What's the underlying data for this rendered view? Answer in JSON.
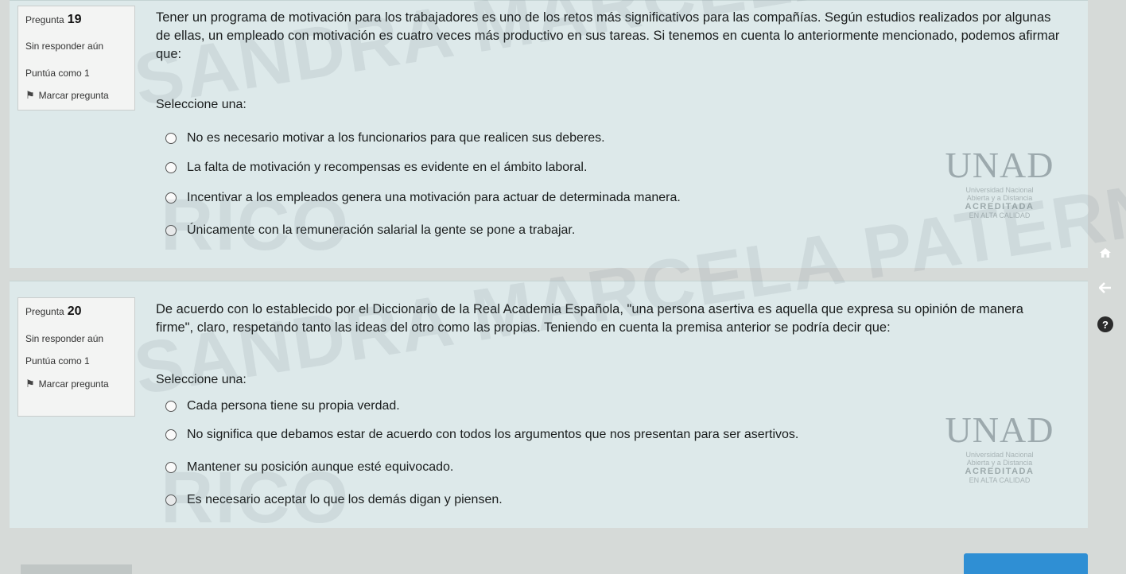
{
  "questions": [
    {
      "label": "Pregunta",
      "number": "19",
      "status": "Sin responder aún",
      "score": "Puntúa como 1",
      "flag_label": "Marcar pregunta",
      "text": "Tener un programa de motivación para los trabajadores es uno de los retos más significativos para las compañías. Según estudios realizados por algunas de ellas, un empleado con motivación es cuatro veces más productivo en sus tareas. Si tenemos en cuenta lo anteriormente mencionado, podemos afirmar que:",
      "prompt": "Seleccione una:",
      "options": [
        "No es necesario motivar a los funcionarios para que realicen sus deberes.",
        "La falta de motivación y recompensas es evidente en el ámbito laboral.",
        "Incentivar a los empleados genera una motivación para actuar de determinada manera.",
        "Únicamente con la remuneración salarial la gente se pone a trabajar."
      ]
    },
    {
      "label": "Pregunta",
      "number": "20",
      "status": "Sin responder aún",
      "score": "Puntúa como 1",
      "flag_label": "Marcar pregunta",
      "text": "De acuerdo con lo establecido por el Diccionario de la Real Academia Española, \"una persona asertiva es aquella que expresa su opinión de manera firme\", claro, respetando tanto las ideas del otro como las propias. Teniendo en cuenta la premisa anterior se podría decir que:",
      "prompt": "Seleccione una:",
      "options": [
        "Cada persona tiene su propia verdad.",
        "No significa que debamos estar de acuerdo con todos los argumentos que nos presentan para ser asertivos.",
        "Mantener su posición aunque esté equivocado.",
        "Es necesario aceptar lo que los demás digan y piensen."
      ]
    }
  ],
  "watermark": {
    "line1": "SANDRA MARCELA PATERNINA",
    "line2": "RICO"
  },
  "logo": {
    "name": "UNAD",
    "subtitle_1": "Universidad Nacional",
    "subtitle_2": "Abierta y a Distancia",
    "badge_1": "ACREDITADA",
    "badge_2": "EN ALTA CALIDAD"
  },
  "side_icons": [
    "home-icon",
    "back-arrow-icon",
    "help-icon"
  ],
  "colors": {
    "panel": "#dde9ea",
    "info_box": "#f3f4f3",
    "accent_blue": "#2f8fd4"
  }
}
